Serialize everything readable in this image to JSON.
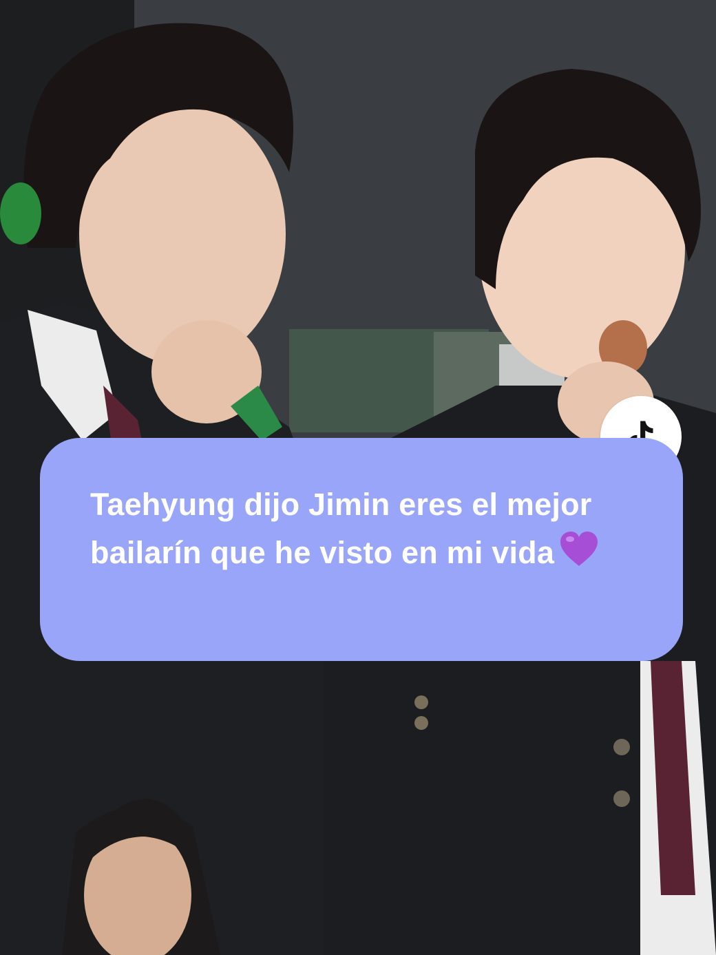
{
  "caption": {
    "text": "Taehyung dijo Jimin eres el mejor bailarín que he visto en mi vida",
    "emoji": "purple-heart-icon",
    "bubble_color": "#99a5f8",
    "text_color": "#ffffff"
  },
  "badge": {
    "icon": "tiktok-logo-icon",
    "background": "#ffffff"
  },
  "video": {
    "description_icon": "video-frame-image"
  }
}
